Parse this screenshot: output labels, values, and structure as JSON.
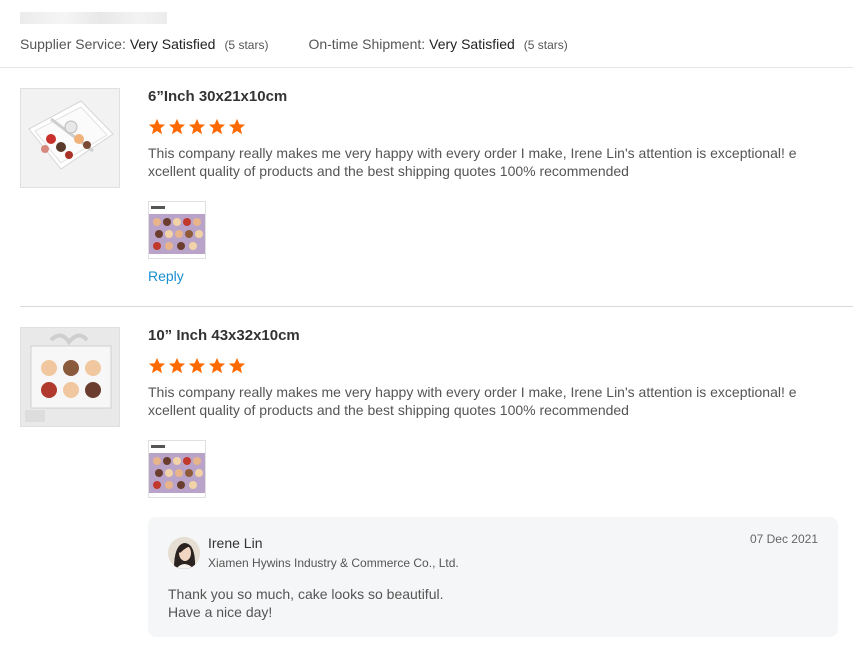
{
  "summary": {
    "supplier_service": {
      "label": "Supplier Service:",
      "value": "Very Satisfied",
      "stars_note": "(5 stars)"
    },
    "on_time_shipment": {
      "label": "On-time Shipment:",
      "value": "Very Satisfied",
      "stars_note": "(5 stars)"
    }
  },
  "colors": {
    "star": "#ff6a00",
    "link": "#1a8fd1",
    "divider": "#d9d9d9"
  },
  "reviews": [
    {
      "spec": "6”Inch 30x21x10cm",
      "rating": 5,
      "comment": "This company really makes me very happy with every order I make, Irene Lin's attention is exceptional! excellent quality of products and the best shipping quotes 100% recommended",
      "reply_label": "Reply"
    },
    {
      "spec": "10” Inch 43x32x10cm",
      "rating": 5,
      "comment": "This company really makes me very happy with every order I make, Irene Lin's attention is exceptional! excellent quality of products and the best shipping quotes 100% recommended"
    }
  ],
  "seller_reply": {
    "name": "Irene Lin",
    "company": "Xiamen Hywins Industry & Commerce Co., Ltd.",
    "date": "07 Dec 2021",
    "text": "Thank you so much,  cake looks so beautiful.\nHave a nice day!"
  }
}
